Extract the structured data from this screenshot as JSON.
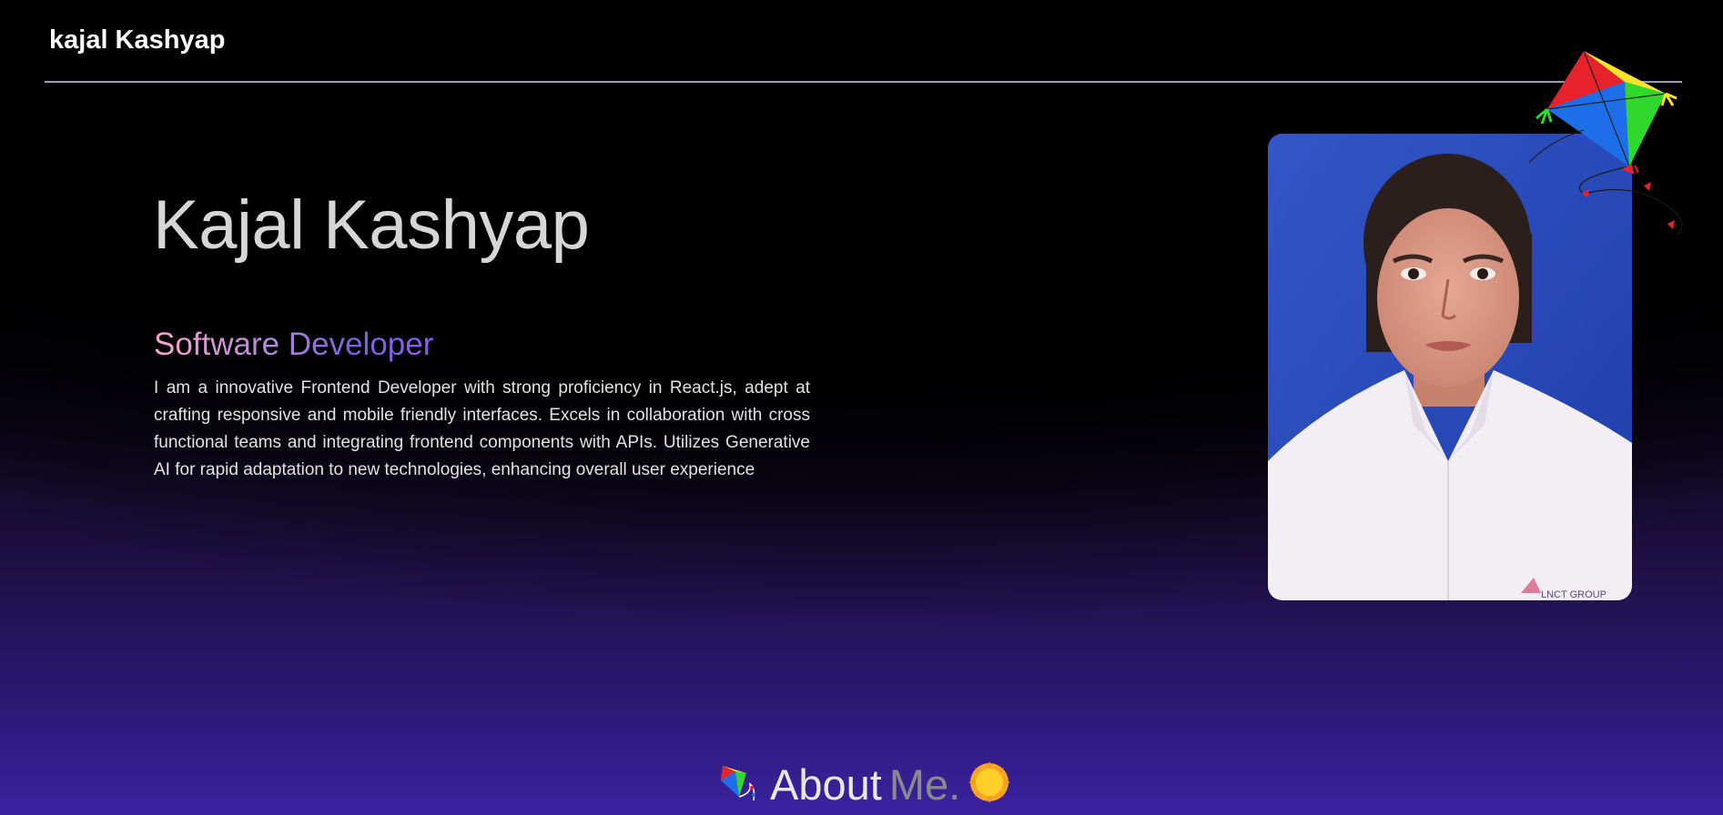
{
  "header": {
    "brand": "kajal Kashyap"
  },
  "hero": {
    "name": "Kajal Kashyap",
    "role": "Software Developer",
    "bio": "I am a innovative Frontend Developer with strong proficiency in React.js, adept at crafting responsive and mobile friendly interfaces. Excels in collaboration with cross functional teams and integrating frontend components with APIs. Utilizes Generative AI for rapid adaptation to new technologies, enhancing overall user experience",
    "photo_icon": "profile-photo",
    "photo_shirt_text": "LNCT GROUP"
  },
  "decorations": {
    "kite_icon": "kite-icon",
    "kite_colors": [
      "#e8222a",
      "#fde32c",
      "#2fd82a",
      "#1d6ee8"
    ]
  },
  "about": {
    "word": "About",
    "me": "Me.",
    "left_icon": "kite-icon",
    "right_icon": "sun-icon"
  },
  "colors": {
    "background_top": "#000000",
    "background_bottom": "#3a22a0",
    "role_gradient_start": "#f4a6c8",
    "role_gradient_end": "#8a5cf0",
    "text_light": "#d6d6d6",
    "text_muted": "#8a8a8a"
  }
}
